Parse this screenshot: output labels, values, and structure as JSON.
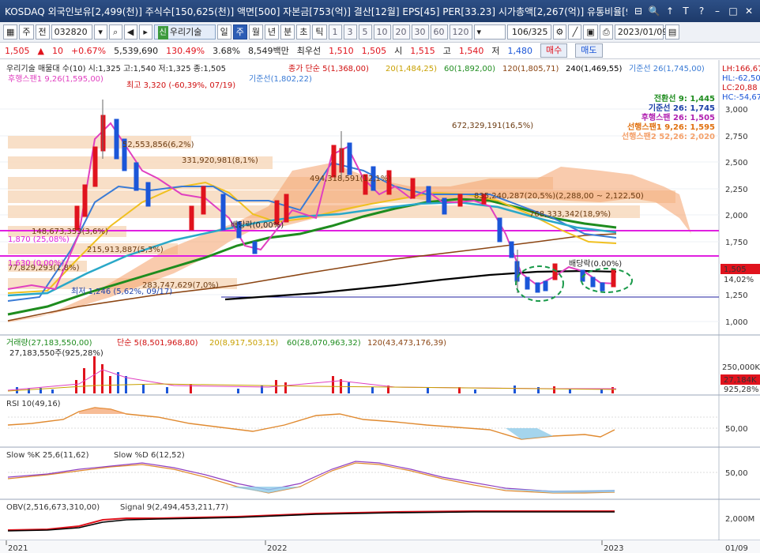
{
  "window": {
    "title": "KOSDAQ 외국인보유[2,499(천)] 주식수[150,625(천)] 액면[500] 자본금[753(억)] 결산[12월] EPS[45] PER[33.23] 시가총액[2,267(억)] 유통비율[91",
    "controls": [
      "⊟",
      "🔍",
      "↑",
      "T",
      "?",
      "–",
      "□",
      "✕"
    ]
  },
  "toolbar": {
    "menu_label": "주",
    "prev_label": "전",
    "code": "032820",
    "sin_badge": "신",
    "stock_name": "우리기술",
    "periods": [
      "일",
      "주",
      "월",
      "년",
      "분",
      "초",
      "틱"
    ],
    "active_period": "주",
    "intervals": [
      "1",
      "3",
      "5",
      "10",
      "20",
      "30",
      "60",
      "120"
    ],
    "page": "106/325",
    "date": "2023/01/09"
  },
  "quote": {
    "price": "1,505",
    "change": "10",
    "change_pct": "+0.67%",
    "volume": "5,539,690",
    "volume_ratio": "130.49%",
    "turnover": "3.68%",
    "amount": "8,549백만",
    "best_ask_label": "최우선",
    "best_ask": "1,510",
    "best_bid": "1,505",
    "open_label": "시",
    "open": "1,515",
    "high_label": "고",
    "high": "1,540",
    "low_label": "저",
    "low": "1,480",
    "buy_label": "매수",
    "sell_label": "매도"
  },
  "colors": {
    "up": "#e0131d",
    "down": "#1b56d8",
    "ma5": "#e040c0",
    "ma20": "#f0c020",
    "ma60": "#1e8c1e",
    "ma120": "#8b4513",
    "ma240": "#000000",
    "base": "#3a7bd5",
    "cloud": "#f4a06a",
    "magenta_line": "#e020e0"
  },
  "price_panel": {
    "header": "우리기술 매물대 수(10) 시:1,325 고:1,540 저:1,325 종:1,505",
    "ma_legend": {
      "ma5": "종가 단순 5(1,368,00)",
      "ma20": "20(1,484,25)",
      "ma60": "60(1,892,00)",
      "ma120": "120(1,805,71)",
      "ma240": "240(1,469,55)",
      "base": "기준선 26(1,745,00)"
    },
    "right_labels": {
      "lh": "LH:166,67",
      "hl": "HL:-62,50",
      "lc": "LC:20,88",
      "hc": "HC:-54,67"
    },
    "ichimoku_legend": {
      "tenkan": "전환선 9: 1,445",
      "kijun": "기준선 26: 1,745",
      "chikou": "후행스팬 26: 1,505",
      "senkou1": "선행스팬1 9,26: 1,595",
      "senkou2": "선행스팬2 52,26: 2,020"
    },
    "annotations": {
      "high": "최고 3,320 (-60,39%, 07/19)",
      "low": "최저 1,246 (5,62%, 09/17)",
      "div1": "배당락(0.00%)",
      "div2": "배당락(0,00%)",
      "ms1": "52,553,856(6,2%)",
      "ms2": "331,920,981(8,1%)",
      "ms3": "672,329,191(16,5%)",
      "ms4": "494,318,591(12,1%)",
      "ms5": "835,240,287(20,5%)(2,288,00 ~ 2,122,50)",
      "ms6": "768,333,342(18,9%)",
      "ms7": "148,673,353(3,6%)",
      "ms8": "215,913,887(5,3%)",
      "ms9": "283,747,629(7,0%)",
      "ms10": "77,829,293(1,8%)",
      "ms11": "1,870 (25,08%)",
      "ms12": "1,630 (0,00%)",
      "hint1": "후행스팬1 9,26(1,595,00)",
      "hint2": "기준선(1,802,22)"
    },
    "price_axis": [
      "3,000",
      "2,750",
      "2,500",
      "2,250",
      "2,000",
      "1,750",
      "1,250",
      "1,000"
    ],
    "current_price": "1,505",
    "current_pct": "14,02%"
  },
  "volume_panel": {
    "legend": "거래량(27,183,550,00)",
    "ma_legend": "단순 5(8,501,968,80)",
    "ma20": "20(8,917,503,15)",
    "ma60": "60(28,070,963,32)",
    "ma120": "120(43,473,176,39)",
    "sub": "27,183,550주(925,28%)",
    "axis": "250,000K",
    "current": "27,184K",
    "current_pct": "925,28%"
  },
  "rsi_panel": {
    "legend": "RSI 10(49,16)",
    "axis": "50,00"
  },
  "slow_panel": {
    "legend_k": "Slow %K 25,6(11,62)",
    "legend_d": "Slow %D 6(12,52)",
    "axis": "50,00"
  },
  "obv_panel": {
    "legend_obv": "OBV(2,516,673,310,00)",
    "legend_signal": "Signal 9(2,494,453,211,77)",
    "axis": "2,000M"
  },
  "time_axis": {
    "labels": [
      "2021",
      "2022",
      "2023"
    ],
    "date": "01/09"
  }
}
